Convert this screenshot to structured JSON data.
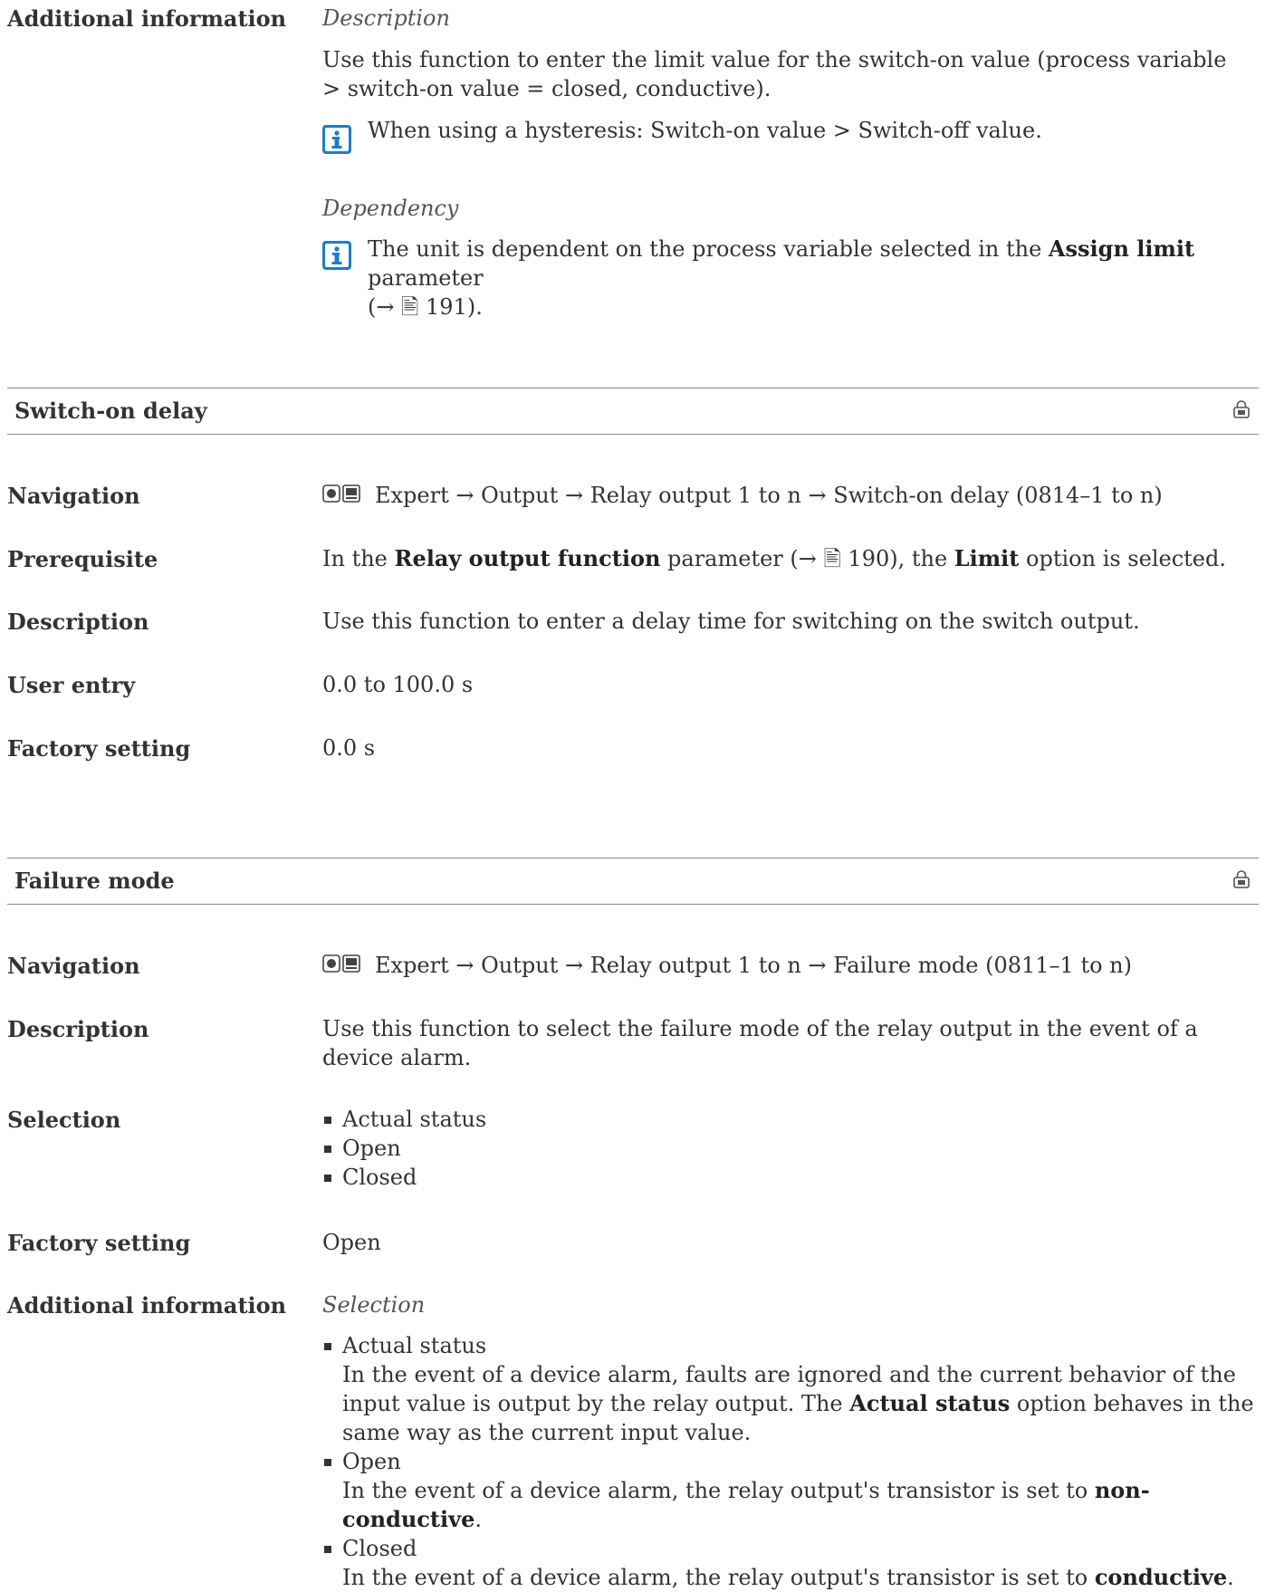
{
  "top": {
    "label": "Additional information",
    "desc_heading": "Description",
    "desc_text": "Use this function to enter the limit value for the switch-on value (process variable > switch-on value = closed, conductive).",
    "note1": "When using a hysteresis: Switch-on value > Switch-off value.",
    "dep_heading": "Dependency",
    "note2_a": "The unit is dependent on the process variable selected in the ",
    "note2_b": "Assign limit",
    "note2_c": " parameter",
    "note2_ref": "(→ 🖹 191)."
  },
  "switch_on_delay": {
    "title": "Switch-on delay",
    "nav_label": "Navigation",
    "nav_value": "Expert → Output → Relay output 1 to n → Switch-on delay (0814–1 to n)",
    "prereq_label": "Prerequisite",
    "prereq_a": "In the ",
    "prereq_b": "Relay output function",
    "prereq_c": " parameter (→ 🖹 190), the ",
    "prereq_d": "Limit",
    "prereq_e": " option is selected.",
    "desc_label": "Description",
    "desc_value": "Use this function to enter a delay time for switching on the switch output.",
    "entry_label": "User entry",
    "entry_value": "0.0 to 100.0 s",
    "factory_label": "Factory setting",
    "factory_value": "0.0 s"
  },
  "failure_mode": {
    "title": "Failure mode",
    "nav_label": "Navigation",
    "nav_value": "Expert → Output → Relay output 1 to n → Failure mode (0811–1 to n)",
    "desc_label": "Description",
    "desc_value": "Use this function to select the failure mode of the relay output in the event of a device alarm.",
    "selection_label": "Selection",
    "options": [
      "Actual status",
      "Open",
      "Closed"
    ],
    "factory_label": "Factory setting",
    "factory_value": "Open",
    "addinfo_label": "Additional information",
    "sel_heading": "Selection",
    "detail": {
      "actual_title": "Actual status",
      "actual_a": "In the event of a device alarm, faults are ignored and the current behavior of the input value is output by the relay output. The ",
      "actual_b": "Actual status",
      "actual_c": " option behaves in the same way as the current input value.",
      "open_title": "Open",
      "open_a": "In the event of a device alarm, the relay output's transistor is set to ",
      "open_b": "non-conductive",
      "open_c": ".",
      "closed_title": "Closed",
      "closed_a": "In the event of a device alarm, the relay output's transistor is set to ",
      "closed_b": "conductive",
      "closed_c": "."
    }
  },
  "icons": [
    "info-icon",
    "lock-icon",
    "operating-tool-icon",
    "display-icon"
  ]
}
